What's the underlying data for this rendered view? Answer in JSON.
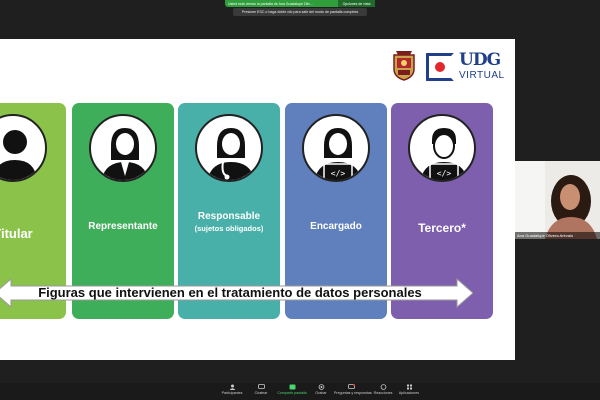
{
  "banner": {
    "sharing_text": "Usted está viendo la pantalla de Ana Guadalupe Oliv...",
    "view_options": "Opciones de vista",
    "esc_hint": "Presione ESC o haga doble clic para salir del modo de pantalla completa"
  },
  "slide": {
    "logo_text": "UDG",
    "logo_subtext": "VIRTUAL",
    "cards": [
      {
        "label": "Titular"
      },
      {
        "label": "Representante"
      },
      {
        "label": "Responsable",
        "sub": "(sujetos obligados)"
      },
      {
        "label": "Encargado"
      },
      {
        "label": "Tercero*"
      }
    ],
    "arrow_text": "Figuras que intervienen en el tratamiento de datos personales"
  },
  "participant": {
    "name": "Ana Guadalupe Olivera Arévalo"
  },
  "toolbar": {
    "items": [
      {
        "label": "Participantes",
        "count": "459",
        "icon": "participants-icon"
      },
      {
        "label": "Chatear",
        "icon": "chat-icon"
      },
      {
        "label": "Compartir pantalla",
        "icon": "share-screen-icon"
      },
      {
        "label": "Grabar",
        "icon": "record-icon"
      },
      {
        "label": "Preguntas y respuestas",
        "icon": "qa-icon"
      },
      {
        "label": "Reacciones",
        "icon": "reactions-icon"
      },
      {
        "label": "Aplicaciones",
        "icon": "apps-icon"
      }
    ]
  }
}
